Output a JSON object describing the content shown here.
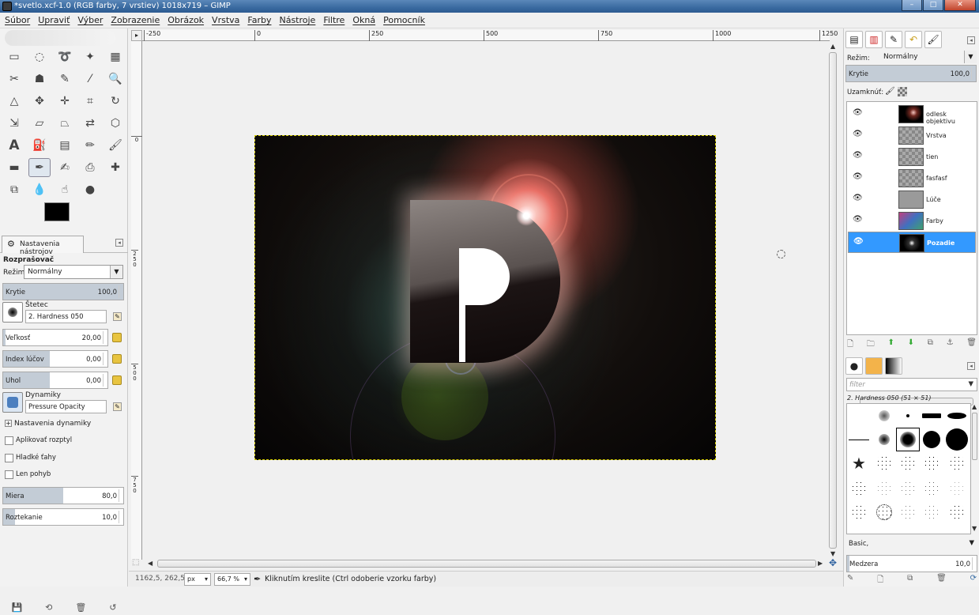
{
  "window": {
    "title": "*svetlo.xcf-1.0 (RGB farby, 7 vrstiev) 1018x719 – GIMP",
    "minimize": "–",
    "maximize": "□",
    "close": "✕"
  },
  "menu": [
    "Súbor",
    "Upraviť",
    "Výber",
    "Zobrazenie",
    "Obrázok",
    "Vrstva",
    "Farby",
    "Nástroje",
    "Filtre",
    "Okná",
    "Pomocník"
  ],
  "tool_options": {
    "tab_label": "Nastavenia nástrojov",
    "tool_name": "Rozprašovač",
    "mode_label": "Režim:",
    "mode_value": "Normálny",
    "opacity": {
      "label": "Krytie",
      "value": "100,0"
    },
    "brush_label": "Štetec",
    "brush_value": "2. Hardness 050",
    "size": {
      "label": "Veľkosť",
      "value": "20,00"
    },
    "aspect": {
      "label": "Index lúčov",
      "value": "0,00"
    },
    "angle": {
      "label": "Uhol",
      "value": "0,00"
    },
    "dynamics_label": "Dynamiky",
    "dynamics_value": "Pressure Opacity",
    "dynamics_settings": "Nastavenia dynamiky",
    "apply_jitter": "Aplikovať rozptyl",
    "smooth_stroke": "Hladké ťahy",
    "lock_brush": "Len pohyb",
    "rate": {
      "label": "Miera",
      "value": "80,0"
    },
    "flow": {
      "label": "Roztekanie",
      "value": "10,0"
    }
  },
  "ruler": {
    "h_labels": [
      "-250",
      "0",
      "250",
      "500",
      "750",
      "1000",
      "1250"
    ],
    "v_labels": [
      "0",
      "2 5 0",
      "5 0 0",
      "7 5 0"
    ]
  },
  "layers_panel": {
    "mode_label": "Režim:",
    "mode_value": "Normálny",
    "opacity_label": "Krytie",
    "opacity_value": "100,0",
    "lock_label": "Uzamknúť:",
    "layers": [
      {
        "name": "odlesk objektivu",
        "selected": false
      },
      {
        "name": "Vrstva",
        "selected": false
      },
      {
        "name": "tien",
        "selected": false
      },
      {
        "name": "fasfasf",
        "selected": false
      },
      {
        "name": "Lúče",
        "selected": false
      },
      {
        "name": "Farby",
        "selected": false
      },
      {
        "name": "Pozadie",
        "selected": true
      }
    ]
  },
  "brushes_panel": {
    "filter_placeholder": "filter",
    "current_brush": "2. Hardness 050 (51 × 51)",
    "preset": "Basic,",
    "spacing_label": "Medzera",
    "spacing_value": "10,0"
  },
  "status": {
    "coords": "1162,5, 262,5",
    "unit": "px",
    "zoom": "66,7 %",
    "message": "Kliknutím kreslite (Ctrl odoberie vzorku farby)"
  },
  "colors": {
    "foreground": "#000000",
    "background": "#ffffff",
    "selection": "#3399ff"
  }
}
